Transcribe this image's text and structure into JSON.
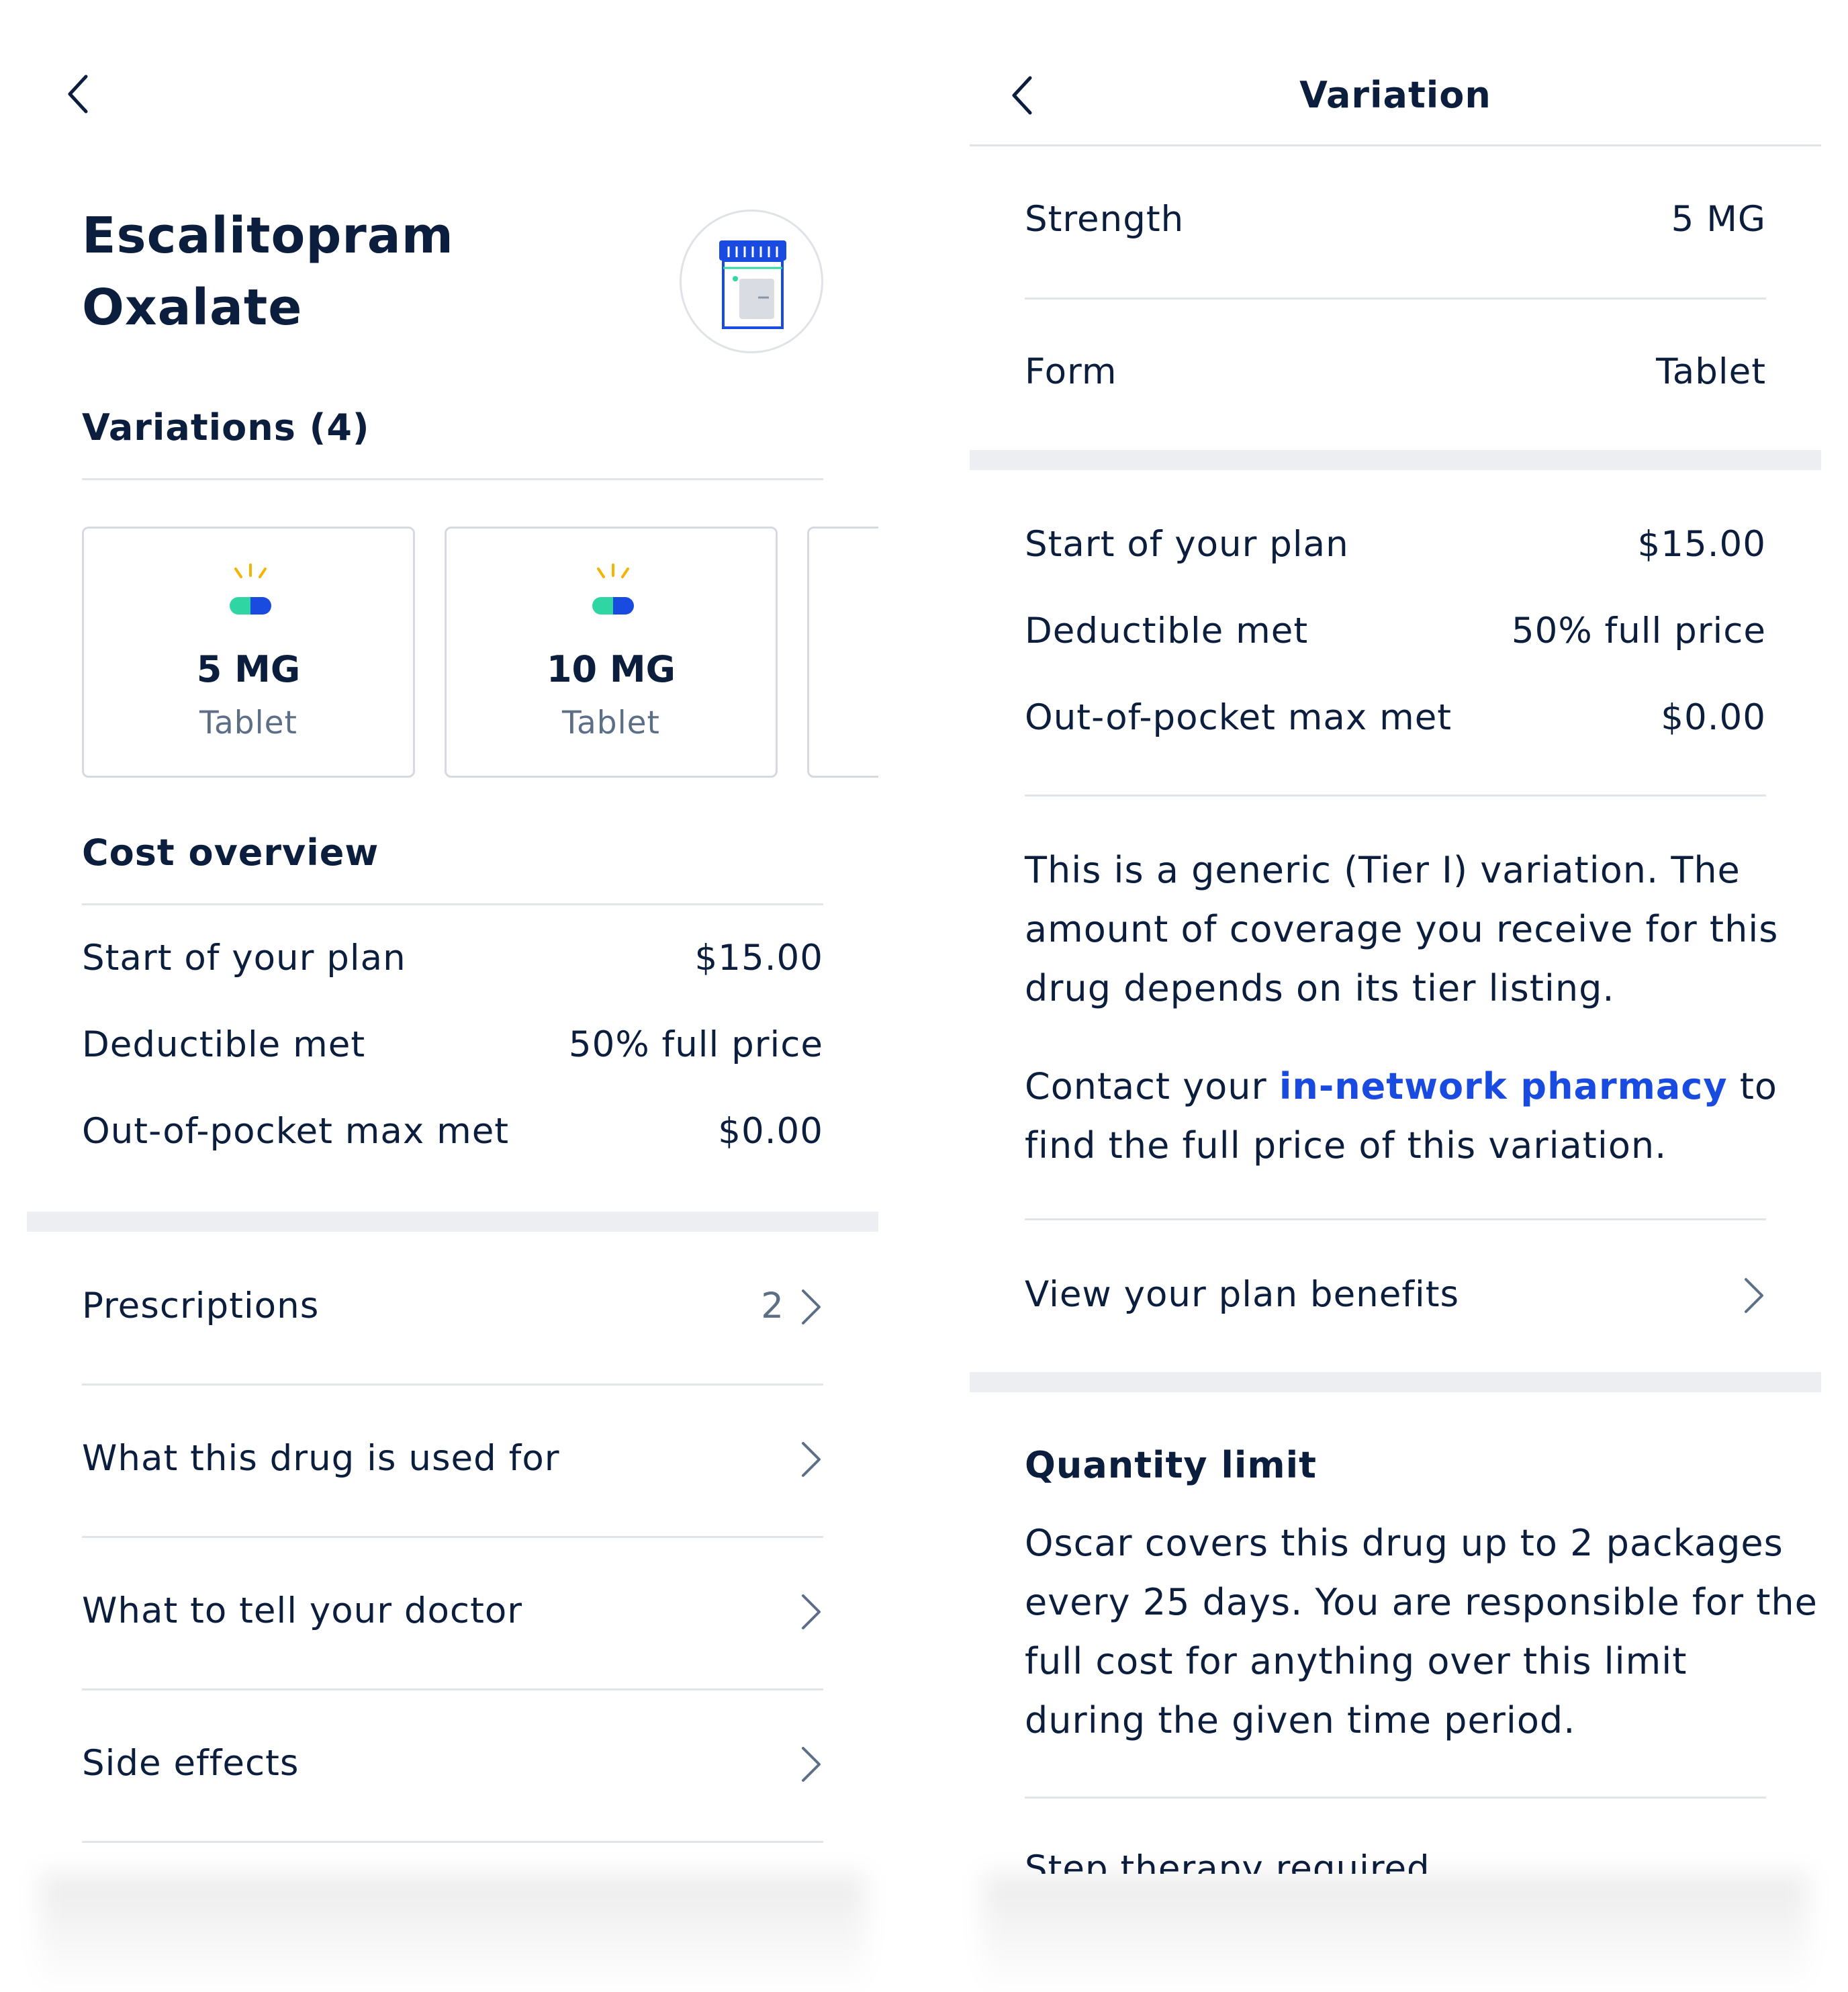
{
  "left": {
    "drug_name_line1": "Escalitopram",
    "drug_name_line2": "Oxalate",
    "variations_header": "Variations (4)",
    "variation_cards": [
      {
        "strength": "5 MG",
        "form": "Tablet"
      },
      {
        "strength": "10 MG",
        "form": "Tablet"
      }
    ],
    "cost_overview_header": "Cost overview",
    "cost_rows": [
      {
        "label": "Start of your plan",
        "value": "$15.00"
      },
      {
        "label": "Deductible met",
        "value": "50% full price"
      },
      {
        "label": "Out-of-pocket max met",
        "value": "$0.00"
      }
    ],
    "nav_items": [
      {
        "label": "Prescriptions",
        "count": "2"
      },
      {
        "label": "What this drug is used for"
      },
      {
        "label": "What to tell your doctor"
      },
      {
        "label": "Side effects"
      }
    ]
  },
  "right": {
    "header_title": "Variation",
    "strength_label": "Strength",
    "strength_value": "5 MG",
    "form_label": "Form",
    "form_value": "Tablet",
    "cost_rows": [
      {
        "label": "Start of your plan",
        "value": "$15.00"
      },
      {
        "label": "Deductible met",
        "value": "50% full price"
      },
      {
        "label": "Out-of-pocket max met",
        "value": "$0.00"
      }
    ],
    "tier_text_lines": [
      "This is a generic (Tier I) variation. The",
      "amount of coverage you receive for this",
      "drug depends on its tier listing."
    ],
    "contact_prefix": "Contact your ",
    "contact_link": "in-network pharmacy",
    "contact_suffix": " to",
    "contact_line2": "find the full price of this variation.",
    "plan_benefits_label": "View your plan benefits",
    "quantity_limit_header": "Quantity limit",
    "quantity_limit_lines": [
      "Oscar covers this drug up to 2 packages",
      "every 25 days. You are responsible for the",
      "full cost for anything over this limit",
      "during the given time period."
    ],
    "step_therapy_label": "Step therapy required"
  },
  "colors": {
    "text_primary": "#0c1e3d",
    "text_secondary": "#5d6f87",
    "link": "#1a4be0",
    "pill_green": "#2fd6a3",
    "pill_blue": "#1a4be0",
    "pill_sparkle": "#f4b400",
    "divider": "#e1e4e9"
  },
  "icons": [
    "back-arrow-icon",
    "pill-bottle-icon",
    "pill-icon",
    "chevron-right-icon"
  ]
}
